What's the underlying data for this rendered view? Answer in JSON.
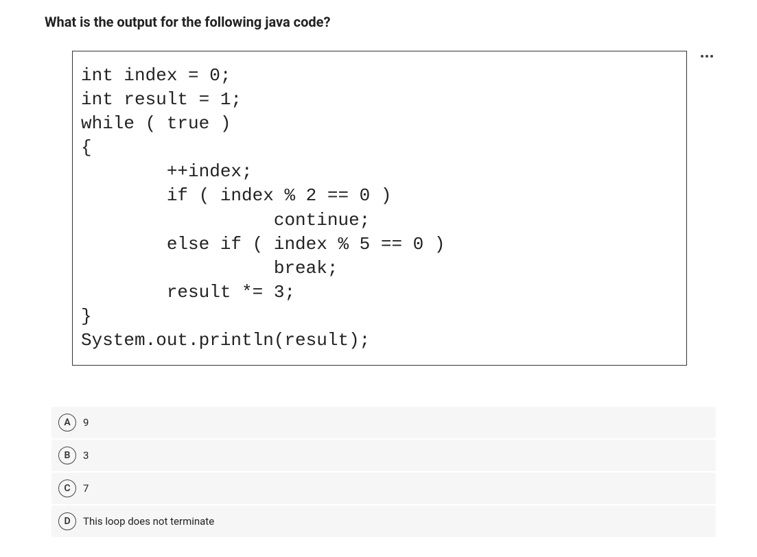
{
  "question": {
    "title": "What is the output for the following java code?",
    "code": "int index = 0;\nint result = 1;\nwhile ( true )\n{\n        ++index;\n        if ( index % 2 == 0 )\n                  continue;\n        else if ( index % 5 == 0 )\n                  break;\n        result *= 3;\n}\nSystem.out.println(result);"
  },
  "options": [
    {
      "letter": "A",
      "text": "9"
    },
    {
      "letter": "B",
      "text": "3"
    },
    {
      "letter": "C",
      "text": "7"
    },
    {
      "letter": "D",
      "text": "This loop does not terminate"
    }
  ]
}
